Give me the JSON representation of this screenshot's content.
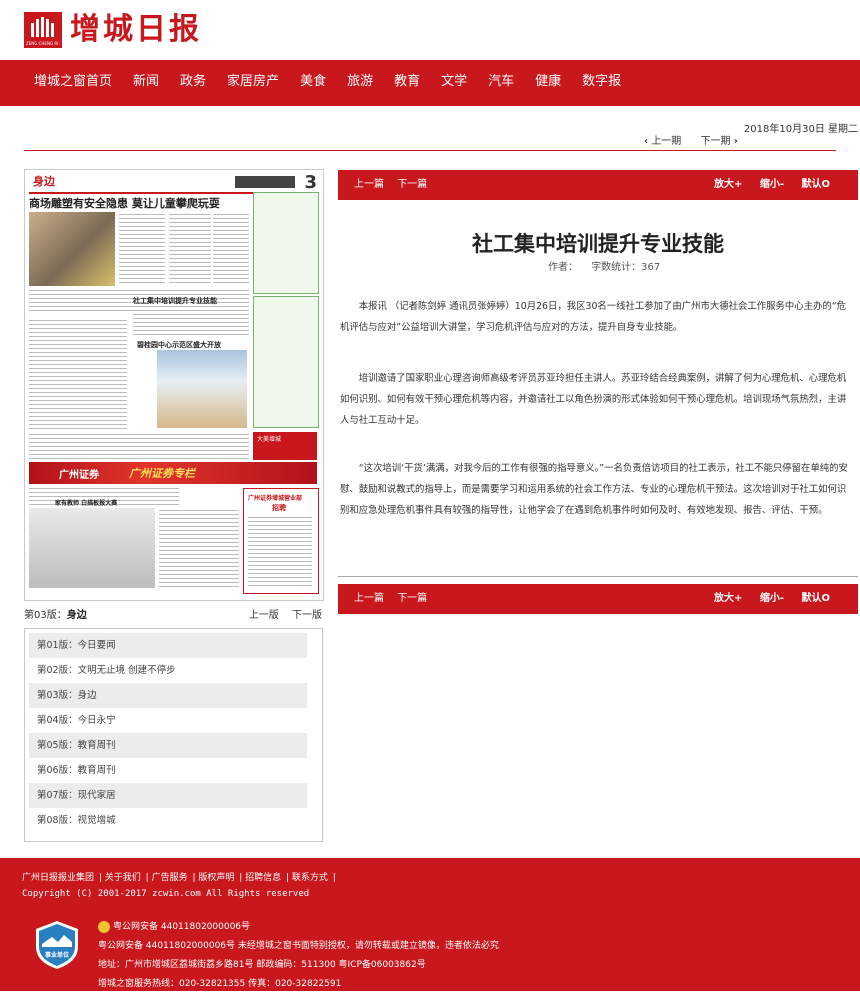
{
  "site": {
    "brand": "增城日报",
    "logo_text": "ZENG CHENG RI BAO"
  },
  "nav": [
    "增城之窗首页",
    "新闻",
    "政务",
    "家居房产",
    "美食",
    "旅游",
    "教育",
    "文学",
    "汽车",
    "健康",
    "数字报"
  ],
  "date": "2018年10月30日 星期二",
  "pager": {
    "prev": "上一期",
    "next": "下一期",
    "prev_arrow": "‹",
    "next_arrow": "›"
  },
  "thumbnail": {
    "section": "身边",
    "page_no": "3",
    "headline": "商场雕塑有安全隐患 莫让儿童攀爬玩耍",
    "sub1": "社工集中培训提升专业技能",
    "sub2": "碧桂园中心示范区盛大开放",
    "ad_text": "广州证券",
    "ad_text2": "广州证券专栏",
    "ad_text3": "广州证券增城营业部",
    "ad_text4": "招聘",
    "side_label": "大美增城",
    "bottom_title": "家有教师 白描板报大赛"
  },
  "article": {
    "toolbar": {
      "prev": "上一篇",
      "next": "下一篇",
      "zoom_in": "放大+",
      "zoom_out": "缩小-",
      "reset": "默认O"
    },
    "title": "社工集中培训提升专业技能",
    "author_label": "作者：",
    "count_label": "字数统计：367",
    "paragraphs": [
      "本报讯 （记者陈剑婷 通讯员张婷婷）10月26日，我区30名一线社工参加了由广州市大德社会工作服务中心主办的“危机评估与应对”公益培训大讲堂，学习危机评估与应对的方法，提升自身专业技能。",
      "培训邀请了国家职业心理咨询师高级考评员苏亚玲担任主讲人。苏亚玲结合经典案例，讲解了何为心理危机、心理危机如何识别、如何有效干预心理危机等内容，并邀请社工以角色扮演的形式体验如何干预心理危机。培训现场气氛热烈，主讲人与社工互动十足。",
      "“这次培训‘干货’满满，对我今后的工作有很强的指导意义。”一名负责倍访项目的社工表示，社工不能只停留在单纯的安慰、鼓励和说教式的指导上，而是需要学习和运用系统的社会工作方法、专业的心理危机干预法。这次培训对于社工如何识别和应急处理危机事件具有较强的指导性，让他学会了在遇到危机事件时如何及时、有效地发现、报告、评估、干预。"
    ]
  },
  "issue": {
    "current_prefix": "第03版：",
    "current_name": "身边",
    "prev_page": "上一版",
    "next_page": "下一版",
    "pages": [
      "第01版：今日要闻",
      "第02版：文明无止境 创建不停步",
      "第03版：身边",
      "第04版：今日永宁",
      "第05版：教育周刊",
      "第06版：教育周刊",
      "第07版：现代家居",
      "第08版：视觉增城"
    ]
  },
  "footer": {
    "links": [
      "广州日报报业集团",
      "关于我们",
      "广告服务",
      "版权声明",
      "招聘信息",
      "联系方式"
    ],
    "copyright": "Copyright (C) 2001-2017 zcwin.com All Rights reserved",
    "icp1": "粤公网安备 44011802000006号",
    "icp2": "粤公网安备 44011802000006号 未经增城之窗书面特别授权，请勿转载或建立镜像，违者依法必究",
    "address": "地址：广州市增城区荔城街荔乡路81号 邮政编码：511300 粤ICP备06003862号",
    "hotline": "增城之窗服务热线：020-32821355 传真：020-32822591",
    "badge_text": "事业单位"
  },
  "colors": {
    "brand_red": "#c8171d",
    "footer_red": "#c8171d"
  }
}
